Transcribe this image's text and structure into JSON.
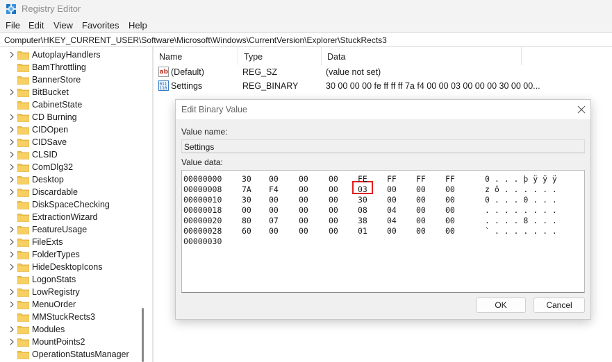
{
  "window": {
    "title": "Registry Editor",
    "menu": [
      "File",
      "Edit",
      "View",
      "Favorites",
      "Help"
    ],
    "address": "Computer\\HKEY_CURRENT_USER\\Software\\Microsoft\\Windows\\CurrentVersion\\Explorer\\StuckRects3"
  },
  "tree": {
    "items": [
      {
        "label": "AutoplayHandlers",
        "expandable": true
      },
      {
        "label": "BamThrottling",
        "expandable": false
      },
      {
        "label": "BannerStore",
        "expandable": false
      },
      {
        "label": "BitBucket",
        "expandable": true
      },
      {
        "label": "CabinetState",
        "expandable": false
      },
      {
        "label": "CD Burning",
        "expandable": true
      },
      {
        "label": "CIDOpen",
        "expandable": true
      },
      {
        "label": "CIDSave",
        "expandable": true
      },
      {
        "label": "CLSID",
        "expandable": true
      },
      {
        "label": "ComDlg32",
        "expandable": true
      },
      {
        "label": "Desktop",
        "expandable": true
      },
      {
        "label": "Discardable",
        "expandable": true
      },
      {
        "label": "DiskSpaceChecking",
        "expandable": false
      },
      {
        "label": "ExtractionWizard",
        "expandable": false
      },
      {
        "label": "FeatureUsage",
        "expandable": true
      },
      {
        "label": "FileExts",
        "expandable": true
      },
      {
        "label": "FolderTypes",
        "expandable": true
      },
      {
        "label": "HideDesktopIcons",
        "expandable": true
      },
      {
        "label": "LogonStats",
        "expandable": false
      },
      {
        "label": "LowRegistry",
        "expandable": true
      },
      {
        "label": "MenuOrder",
        "expandable": true
      },
      {
        "label": "MMStuckRects3",
        "expandable": false
      },
      {
        "label": "Modules",
        "expandable": true
      },
      {
        "label": "MountPoints2",
        "expandable": true
      },
      {
        "label": "OperationStatusManager",
        "expandable": false
      }
    ]
  },
  "list": {
    "columns": [
      "Name",
      "Type",
      "Data"
    ],
    "rows": [
      {
        "icon": "string-value-icon",
        "name": "(Default)",
        "type": "REG_SZ",
        "data": "(value not set)"
      },
      {
        "icon": "binary-value-icon",
        "name": "Settings",
        "type": "REG_BINARY",
        "data": "30 00 00 00 fe ff ff ff 7a f4 00 00 03 00 00 00 30 00 00..."
      }
    ]
  },
  "dialog": {
    "title": "Edit Binary Value",
    "value_name_label": "Value name:",
    "value_name": "Settings",
    "value_data_label": "Value data:",
    "hex_rows": [
      {
        "offset": "00000000",
        "bytes": [
          "30",
          "00",
          "00",
          "00",
          "FE",
          "FF",
          "FF",
          "FF"
        ],
        "ascii": "0 . . . þ ÿ ÿ ÿ"
      },
      {
        "offset": "00000008",
        "bytes": [
          "7A",
          "F4",
          "00",
          "00",
          "03",
          "00",
          "00",
          "00"
        ],
        "ascii": "z ô . . . . . ."
      },
      {
        "offset": "00000010",
        "bytes": [
          "30",
          "00",
          "00",
          "00",
          "30",
          "00",
          "00",
          "00"
        ],
        "ascii": "0 . . . 0 . . ."
      },
      {
        "offset": "00000018",
        "bytes": [
          "00",
          "00",
          "00",
          "00",
          "08",
          "04",
          "00",
          "00"
        ],
        "ascii": ". . . . . . . ."
      },
      {
        "offset": "00000020",
        "bytes": [
          "80",
          "07",
          "00",
          "00",
          "38",
          "04",
          "00",
          "00"
        ],
        "ascii": ". . . . 8 . . ."
      },
      {
        "offset": "00000028",
        "bytes": [
          "60",
          "00",
          "00",
          "00",
          "01",
          "00",
          "00",
          "00"
        ],
        "ascii": "` . . . . . . ."
      },
      {
        "offset": "00000030",
        "bytes": [],
        "ascii": ""
      }
    ],
    "highlight_color": "#e02020",
    "ok_label": "OK",
    "cancel_label": "Cancel"
  }
}
